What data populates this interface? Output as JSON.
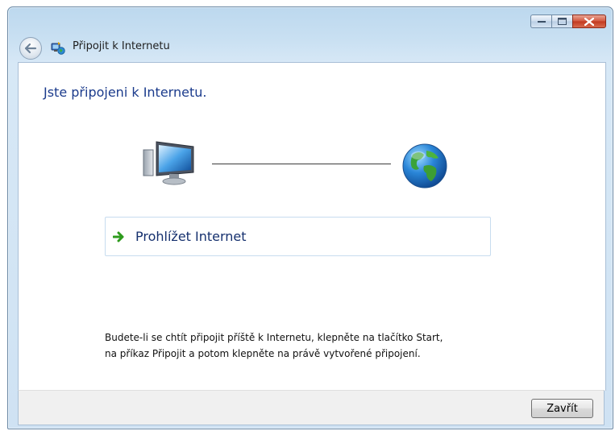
{
  "window": {
    "title": "Připojit k Internetu"
  },
  "content": {
    "heading": "Jste připojeni k Internetu.",
    "browse_label": "Prohlížet Internet",
    "info_text": "Budete-li se chtít připojit příště k Internetu, klepněte na tlačítko Start,\nna příkaz Připojit a potom klepněte na právě vytvořené připojení."
  },
  "footer": {
    "close_label": "Zavřít"
  },
  "icons": {
    "back": "back-arrow-icon",
    "title": "network-connection-icon",
    "computer": "computer-icon",
    "globe": "globe-icon",
    "browse": "green-arrow-icon"
  },
  "colors": {
    "heading": "#1b3b8c",
    "link": "#15306e",
    "close_button": "#c2381f",
    "arrow_green": "#2e9b1d"
  }
}
